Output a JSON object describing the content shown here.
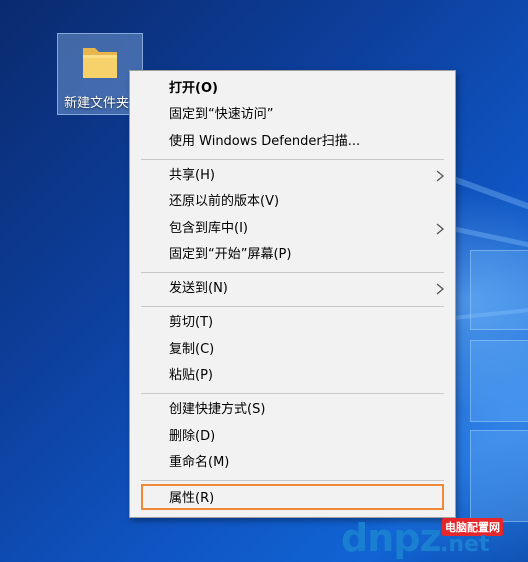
{
  "desktop": {
    "folder_icon": {
      "name": "folder-icon",
      "label": "新建文件夹"
    }
  },
  "context_menu": {
    "groups": [
      [
        {
          "label": "打开(O)",
          "bold": true
        },
        {
          "label": "固定到“快速访问”"
        },
        {
          "label": "使用 Windows Defender扫描..."
        }
      ],
      [
        {
          "label": "共享(H)",
          "submenu": true
        },
        {
          "label": "还原以前的版本(V)"
        },
        {
          "label": "包含到库中(I)",
          "submenu": true
        },
        {
          "label": "固定到“开始”屏幕(P)"
        }
      ],
      [
        {
          "label": "发送到(N)",
          "submenu": true
        }
      ],
      [
        {
          "label": "剪切(T)"
        },
        {
          "label": "复制(C)"
        },
        {
          "label": "粘贴(P)"
        }
      ],
      [
        {
          "label": "创建快捷方式(S)"
        },
        {
          "label": "删除(D)"
        },
        {
          "label": "重命名(M)"
        }
      ],
      [
        {
          "label": "属性(R)",
          "highlighted": true
        }
      ]
    ],
    "submenu_icon": "chevron-right-icon",
    "highlight_color": "#f0883a"
  },
  "watermark": {
    "letters": "dnpz",
    "tld": ".net",
    "site_name": "电脑配置网"
  }
}
